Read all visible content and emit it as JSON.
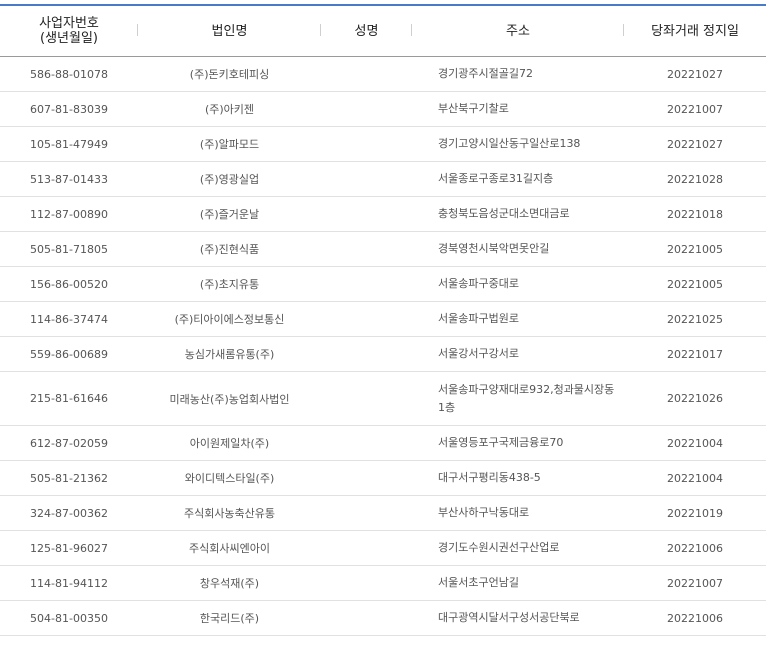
{
  "header": {
    "col_bizno_line1": "사업자번호",
    "col_bizno_line2": "(생년월일)",
    "col_corp": "법인명",
    "col_name": "성명",
    "col_addr": "주소",
    "col_date": "당좌거래 정지일"
  },
  "rows": [
    {
      "bizno": "586-88-01078",
      "corp": "(주)돈키호테피싱",
      "name": "",
      "addr": "경기광주시절골길72",
      "date": "20221027"
    },
    {
      "bizno": "607-81-83039",
      "corp": "(주)아키젠",
      "name": "",
      "addr": "부산북구기찰로",
      "date": "20221007"
    },
    {
      "bizno": "105-81-47949",
      "corp": "(주)알파모드",
      "name": "",
      "addr": "경기고양시일산동구일산로138",
      "date": "20221027"
    },
    {
      "bizno": "513-87-01433",
      "corp": "(주)영광실업",
      "name": "",
      "addr": "서울종로구종로31길지층",
      "date": "20221028"
    },
    {
      "bizno": "112-87-00890",
      "corp": "(주)즐거운날",
      "name": "",
      "addr": "충청북도음성군대소면대금로",
      "date": "20221018"
    },
    {
      "bizno": "505-81-71805",
      "corp": "(주)진현식품",
      "name": "",
      "addr": "경북영천시북악면못안길",
      "date": "20221005"
    },
    {
      "bizno": "156-86-00520",
      "corp": "(주)초지유통",
      "name": "",
      "addr": "서울송파구중대로",
      "date": "20221005"
    },
    {
      "bizno": "114-86-37474",
      "corp": "(주)티아이에스정보통신",
      "name": "",
      "addr": "서울송파구법원로",
      "date": "20221025"
    },
    {
      "bizno": "559-86-00689",
      "corp": "농심가새롬유통(주)",
      "name": "",
      "addr": "서울강서구강서로",
      "date": "20221017"
    },
    {
      "bizno": "215-81-61646",
      "corp": "미래농산(주)농업회사법인",
      "name": "",
      "addr": "서울송파구양재대로932,청과물시장동1층",
      "date": "20221026"
    },
    {
      "bizno": "612-87-02059",
      "corp": "아이원제일차(주)",
      "name": "",
      "addr": "서울영등포구국제금융로70",
      "date": "20221004"
    },
    {
      "bizno": "505-81-21362",
      "corp": "와이디텍스타일(주)",
      "name": "",
      "addr": "대구서구평리동438-5",
      "date": "20221004"
    },
    {
      "bizno": "324-87-00362",
      "corp": "주식회사농축산유통",
      "name": "",
      "addr": "부산사하구낙동대로",
      "date": "20221019"
    },
    {
      "bizno": "125-81-96027",
      "corp": "주식회사씨엔아이",
      "name": "",
      "addr": "경기도수원시권선구산업로",
      "date": "20221006"
    },
    {
      "bizno": "114-81-94112",
      "corp": "창우석재(주)",
      "name": "",
      "addr": "서울서초구언남길",
      "date": "20221007"
    },
    {
      "bizno": "504-81-00350",
      "corp": "한국리드(주)",
      "name": "",
      "addr": "대구광역시달서구성서공단북로",
      "date": "20221006"
    }
  ]
}
